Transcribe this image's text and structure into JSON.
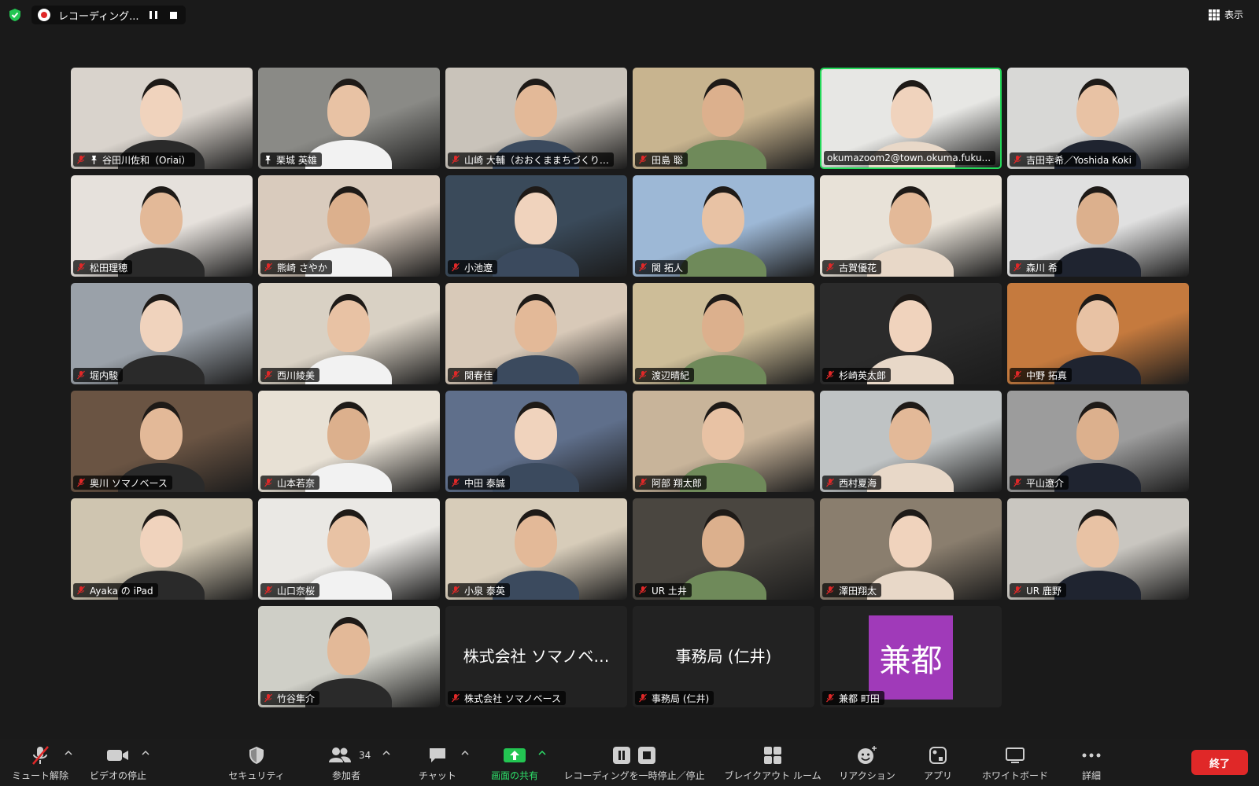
{
  "topbar": {
    "recording_label": "レコーディング...",
    "view_label": "表示"
  },
  "participants": [
    {
      "name": "谷田川佐和（Oriai）",
      "pinned": true,
      "mic_muted": true
    },
    {
      "name": "栗城 英雄",
      "pinned": true,
      "mic_muted": false
    },
    {
      "name": "山崎 大輔（おおくままちづくり…",
      "pinned": false,
      "mic_muted": true
    },
    {
      "name": "田島 聡",
      "pinned": false,
      "mic_muted": true
    },
    {
      "name": "okumazoom2@town.okuma.fuku...",
      "pinned": false,
      "mic_muted": false,
      "active_speaker": true
    },
    {
      "name": "吉田幸希／Yoshida Koki",
      "pinned": false,
      "mic_muted": true
    },
    {
      "name": "松田理穂",
      "pinned": false,
      "mic_muted": true
    },
    {
      "name": "熊崎 さやか",
      "pinned": false,
      "mic_muted": true
    },
    {
      "name": "小池遼",
      "pinned": false,
      "mic_muted": true
    },
    {
      "name": "関 拓人",
      "pinned": false,
      "mic_muted": true
    },
    {
      "name": "古賀優花",
      "pinned": false,
      "mic_muted": true
    },
    {
      "name": "森川 希",
      "pinned": false,
      "mic_muted": true
    },
    {
      "name": "堀内駿",
      "pinned": false,
      "mic_muted": true
    },
    {
      "name": "西川綾美",
      "pinned": false,
      "mic_muted": true
    },
    {
      "name": "関春佳",
      "pinned": false,
      "mic_muted": true
    },
    {
      "name": "渡辺晴紀",
      "pinned": false,
      "mic_muted": true
    },
    {
      "name": "杉崎英太郎",
      "pinned": false,
      "mic_muted": true
    },
    {
      "name": "中野 拓真",
      "pinned": false,
      "mic_muted": true
    },
    {
      "name": "奥川 ソマノベース",
      "pinned": false,
      "mic_muted": true
    },
    {
      "name": "山本若奈",
      "pinned": false,
      "mic_muted": true
    },
    {
      "name": "中田 泰誠",
      "pinned": false,
      "mic_muted": true
    },
    {
      "name": "阿部 翔太郎",
      "pinned": false,
      "mic_muted": true
    },
    {
      "name": "西村夏海",
      "pinned": false,
      "mic_muted": true
    },
    {
      "name": "平山遼介",
      "pinned": false,
      "mic_muted": true
    },
    {
      "name": "Ayaka の iPad",
      "pinned": false,
      "mic_muted": true
    },
    {
      "name": "山口奈桜",
      "pinned": false,
      "mic_muted": true
    },
    {
      "name": "小泉 泰英",
      "pinned": false,
      "mic_muted": true
    },
    {
      "name": "UR 土井",
      "pinned": false,
      "mic_muted": true
    },
    {
      "name": "澤田翔太",
      "pinned": false,
      "mic_muted": true
    },
    {
      "name": "UR 鹿野",
      "pinned": false,
      "mic_muted": true
    },
    {
      "name": "竹谷隼介",
      "pinned": false,
      "mic_muted": true
    },
    {
      "name": "株式会社 ソマノベース",
      "pinned": false,
      "mic_muted": true,
      "video_off_title": "株式会社 ソマノベ…"
    },
    {
      "name": "事務局 (仁井)",
      "pinned": false,
      "mic_muted": true,
      "video_off_title": "事務局 (仁井)"
    },
    {
      "name": "兼都 町田",
      "pinned": false,
      "mic_muted": true,
      "avatar_text": "兼都",
      "avatar_color": "#a03ab9"
    }
  ],
  "toolbar": {
    "unmute": "ミュート解除",
    "stop_video": "ビデオの停止",
    "security": "セキュリティ",
    "participants": "参加者",
    "participants_count": "34",
    "chat": "チャット",
    "share_screen": "画面の共有",
    "recording": "レコーディングを一時停止／停止",
    "breakout": "ブレイクアウト ルーム",
    "reactions": "リアクション",
    "apps": "アプリ",
    "whiteboard": "ホワイトボード",
    "more": "詳細",
    "end": "終了"
  },
  "colors": {
    "active_speaker_border": "#23d959",
    "muted_red": "#e02828",
    "share_green": "#2ee06a",
    "end_button": "#e02828"
  }
}
